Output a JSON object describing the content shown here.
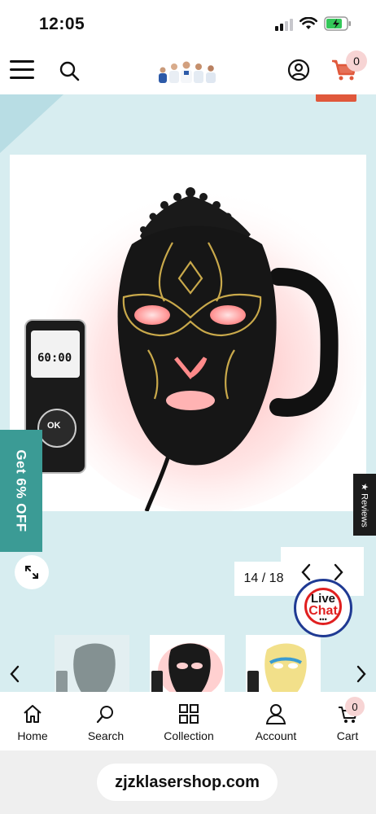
{
  "status_bar": {
    "time": "12:05",
    "battery_color": "#34c759"
  },
  "header": {
    "menu_icon": "hamburger-icon",
    "search_icon": "search-icon",
    "logo": "doctors-logo",
    "account_icon": "user-circle-icon",
    "cart_icon": "cart-icon",
    "cart_count": "0",
    "accent_color": "#e0583b"
  },
  "gallery": {
    "promo_label": "Get 6% OFF",
    "reviews_label": "★ Reviews",
    "counter": "14 / 18",
    "expand_icon": "expand-icon",
    "prev_icon": "chevron-left-icon",
    "next_icon": "chevron-right-icon",
    "remote_display": "60:00",
    "remote_ok": "OK",
    "thumbnails": [
      "mask-thumb-black",
      "mask-thumb-black-red",
      "mask-thumb-colored"
    ],
    "promo_color": "#3b9b95"
  },
  "live_chat": {
    "line1": "Live",
    "line2": "Chat",
    "dots": "•••"
  },
  "bottom_nav": {
    "items": [
      {
        "label": "Home",
        "icon": "home-icon"
      },
      {
        "label": "Search",
        "icon": "search-icon"
      },
      {
        "label": "Collection",
        "icon": "grid-icon"
      },
      {
        "label": "Account",
        "icon": "user-icon"
      },
      {
        "label": "Cart",
        "icon": "cart-icon",
        "count": "0"
      }
    ]
  },
  "browser": {
    "url": "zjzklasershop.com"
  }
}
